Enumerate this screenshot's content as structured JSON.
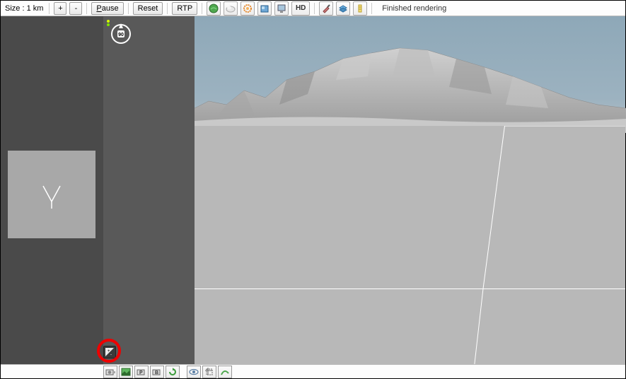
{
  "toolbar": {
    "size_prefix": "Size : ",
    "size_value": "1 km",
    "plus": "+",
    "minus": "-",
    "pause": "Pause",
    "reset": "Reset",
    "rtp": "RTP",
    "hd": "HD"
  },
  "status": {
    "text": "Finished rendering"
  },
  "icons": {
    "top": [
      "globe-green-icon",
      "cloud-icon",
      "gear-orange-icon",
      "box-blue-icon",
      "monitor-icon",
      "hd-icon"
    ],
    "top_right": [
      "brush-icon",
      "layers-blue-icon",
      "scale-yellow-icon"
    ],
    "bottom": [
      "camera-icon",
      "landscape-green-icon",
      "camera-p-icon",
      "camera-b-icon",
      "refresh-green-icon",
      "eye-icon",
      "crop-icon",
      "curve-green-icon"
    ]
  },
  "compass": {
    "angle": "90",
    "dot1": "#d8ff00",
    "dot2": "#7fe500"
  }
}
